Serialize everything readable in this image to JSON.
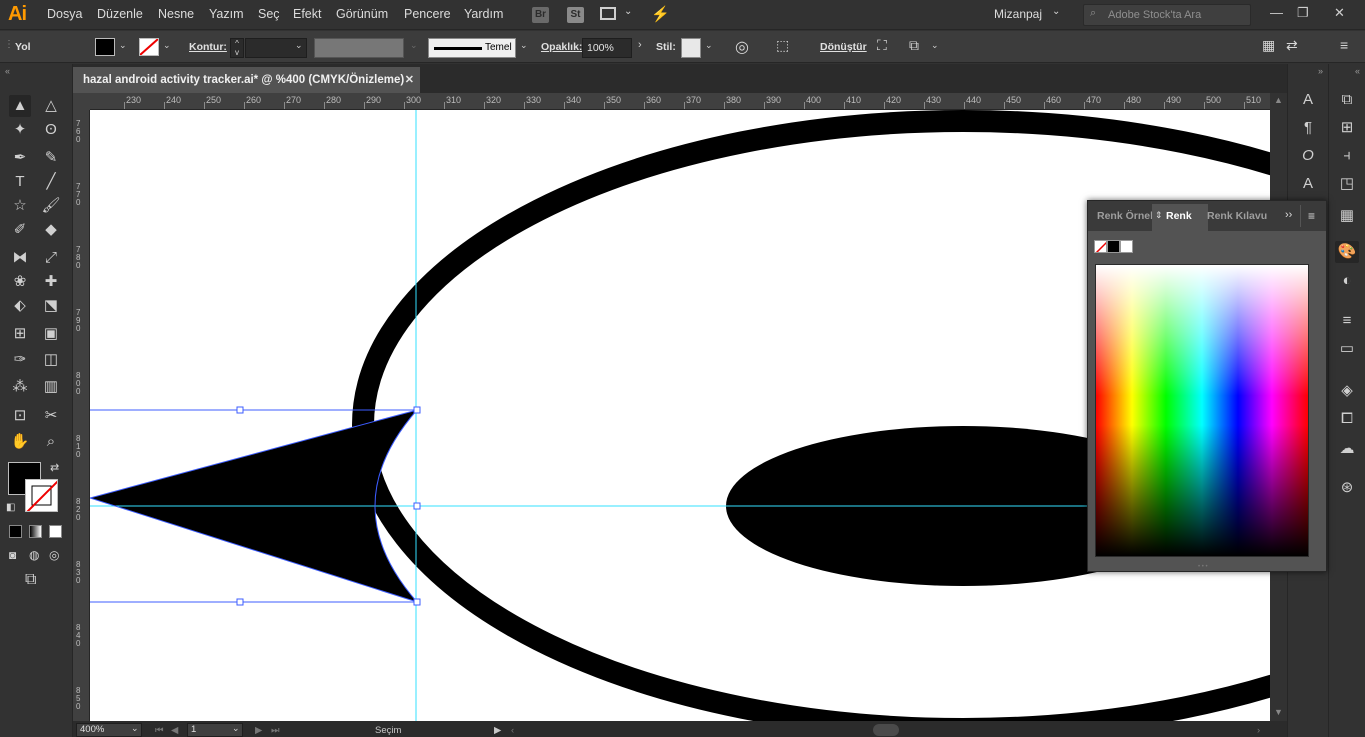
{
  "app": {
    "logo": "Ai"
  },
  "menu": [
    "Dosya",
    "Düzenle",
    "Nesne",
    "Yazım",
    "Seç",
    "Efekt",
    "Görünüm",
    "Pencere",
    "Yardım"
  ],
  "badges": {
    "bridge": "Br",
    "stock": "St"
  },
  "workspace": {
    "label": "Mizanpaj"
  },
  "search": {
    "placeholder": "Adobe Stock'ta Ara"
  },
  "control": {
    "object_type": "Yol",
    "stroke_label": "Kontur:",
    "brush_label": "Temel",
    "opacity_label": "Opaklık:",
    "opacity_value": "100%",
    "style_label": "Stil:",
    "transform_label": "Dönüştür"
  },
  "document": {
    "tab_title": "hazal android activity tracker.ai* @ %400 (CMYK/Önizleme)"
  },
  "ruler": {
    "h_ticks": [
      "230",
      "240",
      "250",
      "260",
      "270",
      "280",
      "290",
      "300",
      "310",
      "320",
      "330",
      "340",
      "350",
      "360",
      "370",
      "380",
      "390",
      "400",
      "410",
      "420",
      "430",
      "440",
      "450",
      "460",
      "470",
      "480",
      "490",
      "500",
      "510"
    ],
    "v_ticks": [
      "7\n6\n0",
      "7\n7\n0",
      "7\n8\n0",
      "7\n9\n0",
      "8\n0\n0",
      "8\n1\n0",
      "8\n2\n0",
      "8\n3\n0",
      "8\n4\n0",
      "8\n5\n0"
    ]
  },
  "color_panel": {
    "tabs": [
      "Renk Örnek",
      "Renk",
      "Renk Kılavu"
    ],
    "active_tab": "Renk"
  },
  "status": {
    "zoom": "400%",
    "page": "1",
    "tool": "Seçim"
  },
  "colors": {
    "accent": "#ff9a00",
    "guide": "#33e1ff",
    "selection": "#3c5cff",
    "canvas": "#ffffff"
  },
  "icons": [
    "selection-tool-icon",
    "direct-selection-tool-icon",
    "magic-wand-icon",
    "lasso-icon",
    "pen-tool-icon",
    "curvature-icon",
    "type-tool-icon",
    "line-tool-icon",
    "star-tool-icon",
    "paintbrush-icon",
    "shaper-icon",
    "eraser-icon",
    "reflect-icon",
    "scale-icon",
    "warp-icon",
    "puppet-warp-icon",
    "free-transform-icon",
    "perspective-icon",
    "mesh-icon",
    "gradient-icon",
    "eyedropper-icon",
    "blend-icon",
    "symbol-sprayer-icon",
    "graph-icon",
    "artboard-icon",
    "slice-icon",
    "hand-icon",
    "zoom-icon"
  ]
}
